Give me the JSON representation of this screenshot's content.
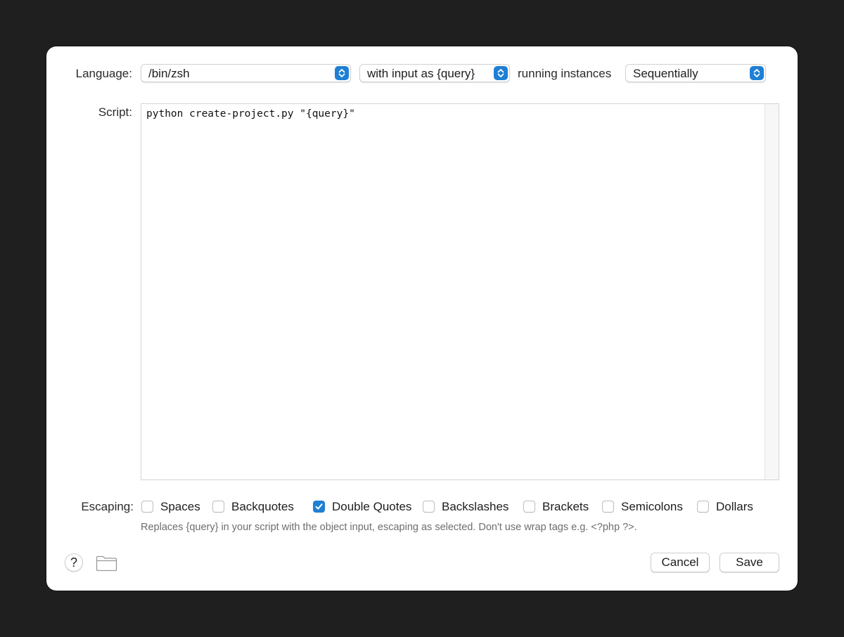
{
  "form": {
    "language_label": "Language:",
    "language_value": "/bin/zsh",
    "input_value": "with input as {query}",
    "running_label": "running instances",
    "running_value": "Sequentially",
    "script_label": "Script:",
    "script_text": "python create-project.py \"{query}\"",
    "escaping_label": "Escaping:",
    "escaping_options": [
      {
        "label": "Spaces",
        "checked": false
      },
      {
        "label": "Backquotes",
        "checked": false
      },
      {
        "label": "Double Quotes",
        "checked": true
      },
      {
        "label": "Backslashes",
        "checked": false
      },
      {
        "label": "Brackets",
        "checked": false
      },
      {
        "label": "Semicolons",
        "checked": false
      },
      {
        "label": "Dollars",
        "checked": false
      }
    ],
    "hint": "Replaces {query} in your script with the object input, escaping as selected. Don't use wrap tags e.g. <?php ?>."
  },
  "footer": {
    "help_label": "?",
    "help_icon": "question-mark-icon",
    "folder_icon": "folder-icon",
    "cancel_label": "Cancel",
    "save_label": "Save"
  },
  "colors": {
    "accent": "#1f7fd4",
    "backdrop": "#1f1f1f",
    "dialog": "#ffffff"
  }
}
